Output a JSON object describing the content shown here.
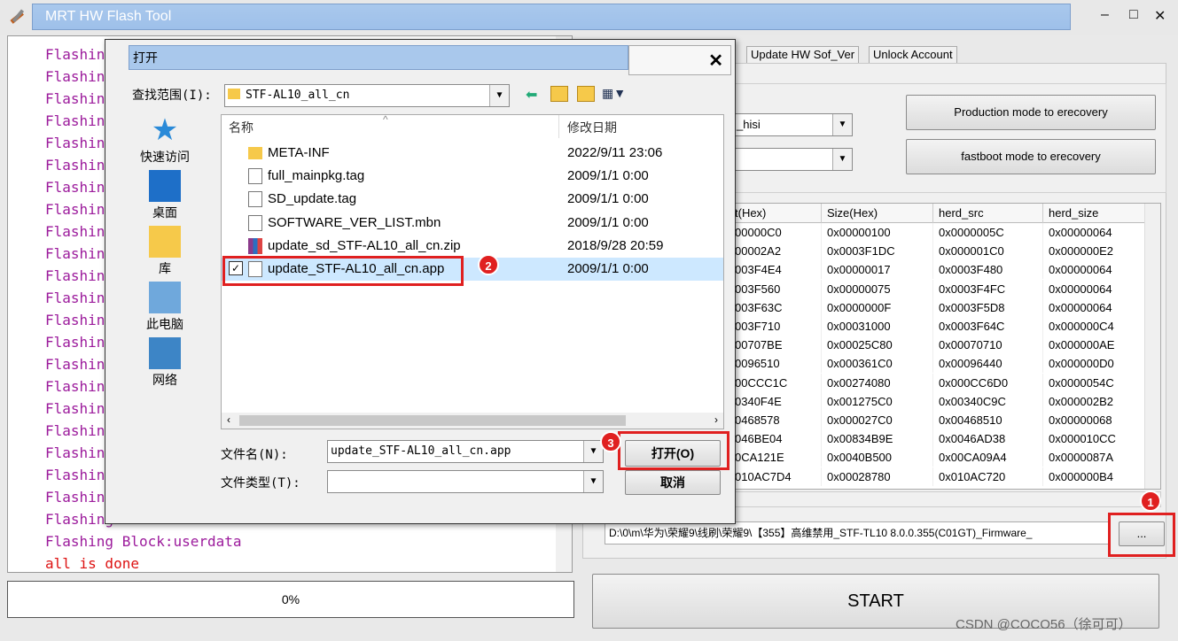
{
  "window": {
    "title": "MRT HW Flash Tool",
    "min": "‒",
    "max": "□",
    "close": "✕"
  },
  "log": {
    "lines": [
      "Flashing",
      "Flashing",
      "Flashing",
      "Flashing",
      "Flashing",
      "Flashing",
      "Flashing",
      "Flashing",
      "Flashing",
      "Flashing",
      "Flashing",
      "Flashing",
      "Flashing",
      "Flashing",
      "Flashing",
      "Flashing",
      "Flashing",
      "Flashing",
      "Flashing",
      "Flashing",
      "Flashing",
      "Flashing"
    ],
    "last_block": "Flashing Block:userdata",
    "done": "all is done"
  },
  "progress": {
    "text": "0%",
    "value": 0
  },
  "tabs": {
    "t1": "Update HW Sof_Ver",
    "t2": "Unlock Account"
  },
  "panel": {
    "combo1": "_hisi",
    "combo2": "",
    "btn_production": "Production mode to erecovery",
    "btn_fastboot": "fastboot mode to erecovery"
  },
  "table": {
    "headers": [
      "t(Hex)",
      "Size(Hex)",
      "herd_src",
      "herd_size"
    ],
    "rows": [
      [
        "00000C0",
        "0x00000100",
        "0x0000005C",
        "0x00000064"
      ],
      [
        "00002A2",
        "0x0003F1DC",
        "0x000001C0",
        "0x000000E2"
      ],
      [
        "003F4E4",
        "0x00000017",
        "0x0003F480",
        "0x00000064"
      ],
      [
        "003F560",
        "0x00000075",
        "0x0003F4FC",
        "0x00000064"
      ],
      [
        "003F63C",
        "0x0000000F",
        "0x0003F5D8",
        "0x00000064"
      ],
      [
        "003F710",
        "0x00031000",
        "0x0003F64C",
        "0x000000C4"
      ],
      [
        "00707BE",
        "0x00025C80",
        "0x00070710",
        "0x000000AE"
      ],
      [
        "0096510",
        "0x000361C0",
        "0x00096440",
        "0x000000D0"
      ],
      [
        "00CCC1C",
        "0x00274080",
        "0x000CC6D0",
        "0x0000054C"
      ],
      [
        "0340F4E",
        "0x001275C0",
        "0x00340C9C",
        "0x000002B2"
      ],
      [
        "0468578",
        "0x000027C0",
        "0x00468510",
        "0x00000068"
      ],
      [
        "046BE04",
        "0x00834B9E",
        "0x0046AD38",
        "0x000010CC"
      ],
      [
        "0CA121E",
        "0x0040B500",
        "0x00CA09A4",
        "0x0000087A"
      ],
      [
        "010AC7D4",
        "0x00028780",
        "0x010AC720",
        "0x000000B4"
      ]
    ]
  },
  "path": {
    "value": "D:\\0\\m\\华为\\荣耀9\\线刷\\荣耀9\\【355】高维禁用_STF-TL10 8.0.0.355(C01GT)_Firmware_",
    "browse": "..."
  },
  "start": "START",
  "watermark": "CSDN @COCO56（徐可可）",
  "badges": {
    "b1": "1",
    "b2": "2",
    "b3": "3"
  },
  "dialog": {
    "title": "打开",
    "close": "✕",
    "lookin_label": "查找范围(I):",
    "lookin_value": "STF-AL10_all_cn",
    "places": [
      {
        "label": "快速访问",
        "icon": "star-icon"
      },
      {
        "label": "桌面",
        "icon": "desktop-icon"
      },
      {
        "label": "库",
        "icon": "library-icon"
      },
      {
        "label": "此电脑",
        "icon": "computer-icon"
      },
      {
        "label": "网络",
        "icon": "network-icon"
      }
    ],
    "col_name": "名称",
    "col_date": "修改日期",
    "files": [
      {
        "name": "META-INF",
        "date": "2022/9/11 23:06",
        "icon": "folder-icon"
      },
      {
        "name": "full_mainpkg.tag",
        "date": "2009/1/1 0:00",
        "icon": "file-icon"
      },
      {
        "name": "SD_update.tag",
        "date": "2009/1/1 0:00",
        "icon": "file-icon"
      },
      {
        "name": "SOFTWARE_VER_LIST.mbn",
        "date": "2009/1/1 0:00",
        "icon": "file-icon"
      },
      {
        "name": "update_sd_STF-AL10_all_cn.zip",
        "date": "2018/9/28 20:59",
        "icon": "zip-icon"
      },
      {
        "name": "update_STF-AL10_all_cn.app",
        "date": "2009/1/1 0:00",
        "icon": "file-icon"
      }
    ],
    "filename_label": "文件名(N):",
    "filename_value": "update_STF-AL10_all_cn.app",
    "filetype_label": "文件类型(T):",
    "filetype_value": "",
    "open_btn": "打开(O)",
    "cancel_btn": "取消"
  }
}
